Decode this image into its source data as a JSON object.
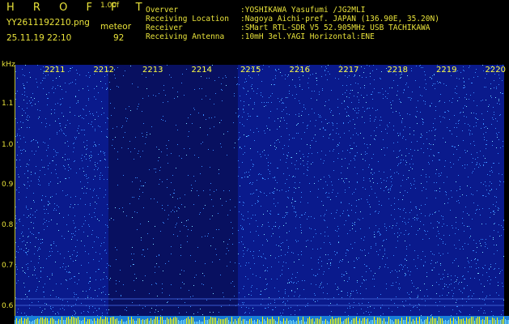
{
  "header": {
    "app_title": "H R O F F T",
    "version": "1.00f",
    "filename": "YY2611192210.png",
    "datetime": "25.11.19 22:10",
    "meteor_label": "meteor",
    "meteor_count": "92"
  },
  "info": [
    {
      "key": "Overver",
      "value": ":YOSHIKAWA Yasufumi /JG2MLI"
    },
    {
      "key": "Receiving Location",
      "value": ":Nagoya Aichi-pref. JAPAN (136.90E, 35.20N)"
    },
    {
      "key": "Receiver",
      "value": ":SMart RTL-SDR V5 52.905MHz USB TACHIKAWA"
    },
    {
      "key": "Receiving Antenna",
      "value": ":10mH 3el.YAGI Horizontal:ENE"
    }
  ],
  "axes": {
    "y_unit": "kHz",
    "y_ticks": [
      "1.1",
      "1.0",
      "0.9",
      "0.8",
      "0.7",
      "0.6"
    ],
    "x_ticks": [
      "2211",
      "2212",
      "2213",
      "2214",
      "2215",
      "2216",
      "2217",
      "2218",
      "2219",
      "2220"
    ]
  },
  "colors": {
    "text": "#e8e23a",
    "tick_label": "#ffff40",
    "background": "#000000",
    "noise_base": "#0a1a8c",
    "noise_dark": "#081060",
    "noise_speck": "#3a8cff",
    "noise_bright": "#7fe0ff",
    "baseline": "#ffff00"
  }
}
